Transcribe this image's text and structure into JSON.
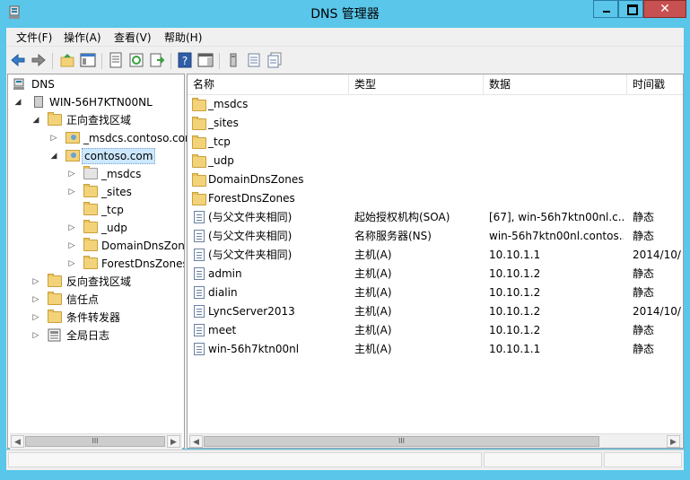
{
  "window": {
    "title": "DNS 管理器",
    "close_glyph": "✕"
  },
  "menu": [
    "文件(F)",
    "操作(A)",
    "查看(V)",
    "帮助(H)"
  ],
  "tree": {
    "root": "DNS",
    "server": "WIN-56H7KTN00NL",
    "forward_zones": "正向查找区域",
    "msdcs_zone": "_msdcs.contoso.com",
    "contoso_zone": "contoso.com",
    "children": [
      "_msdcs",
      "_sites",
      "_tcp",
      "_udp",
      "DomainDnsZones",
      "ForestDnsZones"
    ],
    "reverse_zones": "反向查找区域",
    "trust_points": "信任点",
    "conditional_forwarders": "条件转发器",
    "global_logs": "全局日志"
  },
  "list": {
    "headers": [
      "名称",
      "类型",
      "数据",
      "时间戳"
    ],
    "rows": [
      {
        "name": "_msdcs",
        "type": "",
        "data": "",
        "timestamp": "",
        "icon": "folder"
      },
      {
        "name": "_sites",
        "type": "",
        "data": "",
        "timestamp": "",
        "icon": "folder"
      },
      {
        "name": "_tcp",
        "type": "",
        "data": "",
        "timestamp": "",
        "icon": "folder"
      },
      {
        "name": "_udp",
        "type": "",
        "data": "",
        "timestamp": "",
        "icon": "folder"
      },
      {
        "name": "DomainDnsZones",
        "type": "",
        "data": "",
        "timestamp": "",
        "icon": "folder"
      },
      {
        "name": "ForestDnsZones",
        "type": "",
        "data": "",
        "timestamp": "",
        "icon": "folder"
      },
      {
        "name": "(与父文件夹相同)",
        "type": "起始授权机构(SOA)",
        "data": "[67], win-56h7ktn00nl.c...",
        "timestamp": "静态",
        "icon": "record"
      },
      {
        "name": "(与父文件夹相同)",
        "type": "名称服务器(NS)",
        "data": "win-56h7ktn00nl.contos...",
        "timestamp": "静态",
        "icon": "record"
      },
      {
        "name": "(与父文件夹相同)",
        "type": "主机(A)",
        "data": "10.10.1.1",
        "timestamp": "2014/10/",
        "icon": "record"
      },
      {
        "name": "admin",
        "type": "主机(A)",
        "data": "10.10.1.2",
        "timestamp": "静态",
        "icon": "record"
      },
      {
        "name": "dialin",
        "type": "主机(A)",
        "data": "10.10.1.2",
        "timestamp": "静态",
        "icon": "record"
      },
      {
        "name": "LyncServer2013",
        "type": "主机(A)",
        "data": "10.10.1.2",
        "timestamp": "2014/10/",
        "icon": "record"
      },
      {
        "name": "meet",
        "type": "主机(A)",
        "data": "10.10.1.2",
        "timestamp": "静态",
        "icon": "record"
      },
      {
        "name": "win-56h7ktn00nl",
        "type": "主机(A)",
        "data": "10.10.1.1",
        "timestamp": "静态",
        "icon": "record"
      }
    ]
  },
  "scroll": {
    "left": "◀",
    "right": "▶",
    "grip": "III"
  },
  "colors": {
    "titlebar": "#59c6ea",
    "close": "#c75050",
    "selection": "#cce8ff"
  }
}
